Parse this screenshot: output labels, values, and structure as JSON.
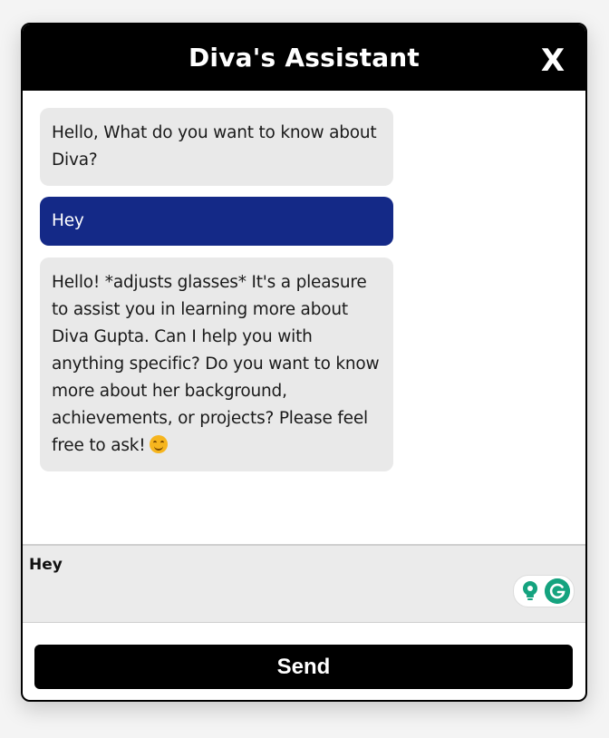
{
  "header": {
    "title": "Diva's Assistant",
    "close_label": "X"
  },
  "messages": [
    {
      "role": "assistant",
      "text": "Hello, What do you want to know about Diva?"
    },
    {
      "role": "user",
      "text": "Hey"
    },
    {
      "role": "assistant",
      "text": "Hello! *adjusts glasses* It's a pleasure to assist you in learning more about Diva Gupta. Can I help you with anything specific? Do you want to know more about her background, achievements, or projects? Please feel free to ask!",
      "emoji": "smiling-face-icon"
    }
  ],
  "input": {
    "value": "Hey"
  },
  "send": {
    "label": "Send"
  },
  "colors": {
    "header_bg": "#000000",
    "assistant_bubble": "#e9e9e9",
    "user_bubble": "#142987",
    "input_bg": "#ebebeb",
    "grammarly_green": "#15a37f"
  },
  "icons": {
    "close": "close-icon",
    "grammarly_suggestion": "lightbulb-icon",
    "grammarly_logo": "grammarly-g-icon"
  }
}
